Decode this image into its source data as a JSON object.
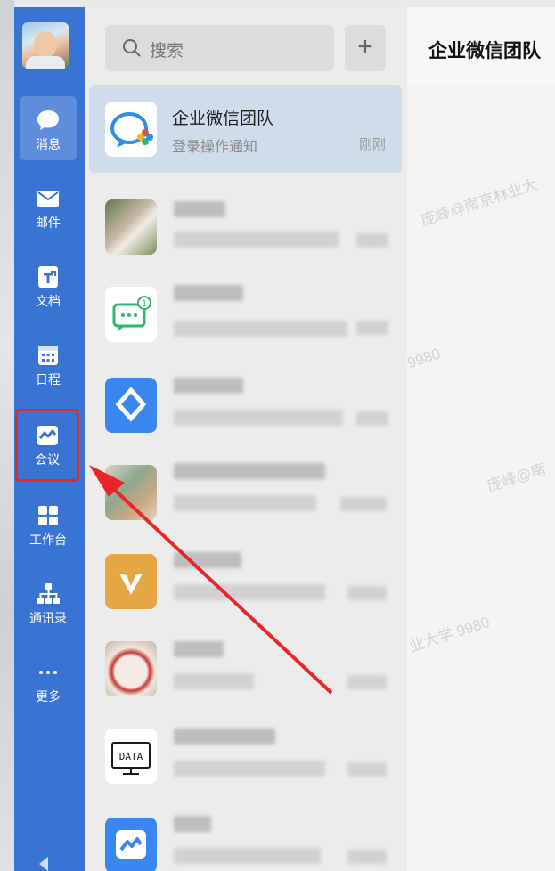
{
  "sidebar": {
    "items": [
      {
        "label": "消息",
        "icon": "chat-bubble-icon"
      },
      {
        "label": "邮件",
        "icon": "mail-icon"
      },
      {
        "label": "文档",
        "icon": "document-icon"
      },
      {
        "label": "日程",
        "icon": "calendar-icon"
      },
      {
        "label": "会议",
        "icon": "meeting-icon"
      },
      {
        "label": "工作台",
        "icon": "workbench-grid-icon"
      },
      {
        "label": "通讯录",
        "icon": "contacts-org-icon"
      },
      {
        "label": "更多",
        "icon": "more-dots-icon"
      }
    ]
  },
  "search": {
    "placeholder": "搜索",
    "add_label": "+"
  },
  "conversations": [
    {
      "name": "企业微信团队",
      "message": "登录操作通知",
      "time": "刚刚"
    }
  ],
  "main": {
    "title": "企业微信团队"
  },
  "watermarks": [
    "庞峰@南京林业大",
    "9980",
    "庞峰@南",
    "业大学 9980"
  ],
  "colors": {
    "sidebar": "#3a74d3",
    "highlight": "#e8262a",
    "selected": "#cfdcec"
  }
}
